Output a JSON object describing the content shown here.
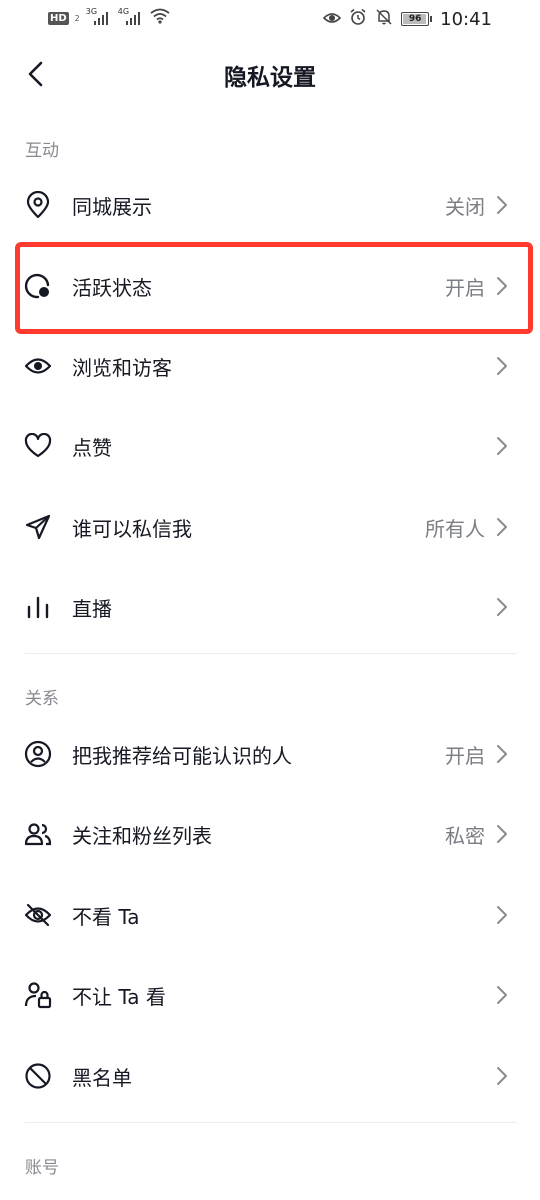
{
  "status_bar": {
    "hd_badge": "HD",
    "hd_num": "2",
    "net1": "3G",
    "net2": "4G",
    "battery": "96",
    "battery_level": 0.96,
    "time": "10:41"
  },
  "header": {
    "title": "隐私设置",
    "back_icon": "back-arrow-icon"
  },
  "sections": {
    "interaction": {
      "title": "互动"
    },
    "relations": {
      "title": "关系"
    },
    "account": {
      "title": "账号"
    }
  },
  "rows": {
    "local_display": {
      "label": "同城展示",
      "value": "关闭",
      "icon": "location-pin-icon"
    },
    "active_status": {
      "label": "活跃状态",
      "value": "开启",
      "icon": "active-status-icon"
    },
    "browse_visitors": {
      "label": "浏览和访客",
      "value": "",
      "icon": "eye-icon"
    },
    "likes": {
      "label": "点赞",
      "value": "",
      "icon": "heart-icon"
    },
    "who_can_message": {
      "label": "谁可以私信我",
      "value": "所有人",
      "icon": "send-icon"
    },
    "live": {
      "label": "直播",
      "value": "",
      "icon": "live-bars-icon"
    },
    "recommend_to_acquaintances": {
      "label": "把我推荐给可能认识的人",
      "value": "开启",
      "icon": "user-circle-icon"
    },
    "follow_fans_list": {
      "label": "关注和粉丝列表",
      "value": "私密",
      "icon": "users-icon"
    },
    "dont_see_ta": {
      "label": "不看 Ta",
      "value": "",
      "icon": "eye-off-icon"
    },
    "dont_let_ta_see": {
      "label": "不让 Ta 看",
      "value": "",
      "icon": "user-lock-icon"
    },
    "blacklist": {
      "label": "黑名单",
      "value": "",
      "icon": "block-icon"
    }
  },
  "colors": {
    "highlight": "#ff3b30",
    "text_primary": "#161823",
    "text_secondary": "#7c7e85"
  }
}
